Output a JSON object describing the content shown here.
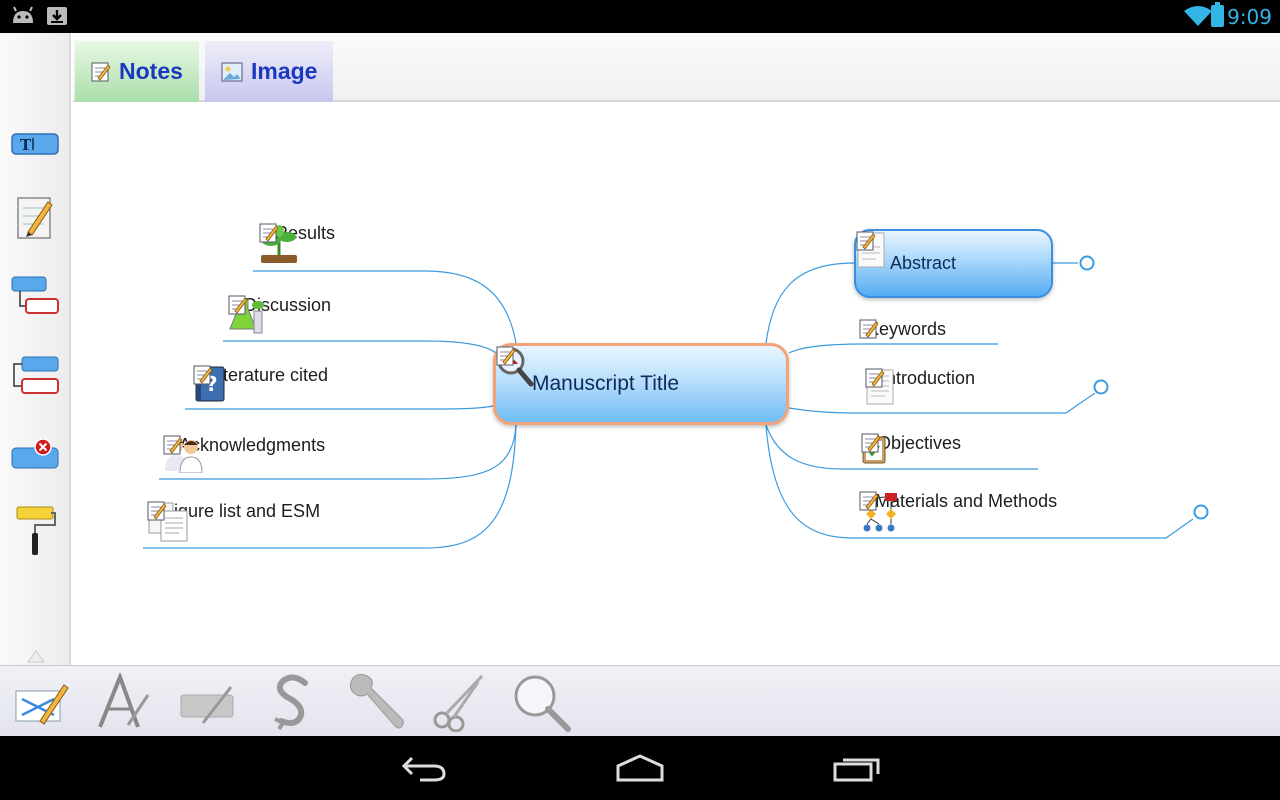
{
  "status_bar": {
    "time": "9:09"
  },
  "tabs": [
    {
      "label": "Notes"
    },
    {
      "label": "Image"
    }
  ],
  "mindmap": {
    "central": "Manuscript Title",
    "left_nodes": [
      {
        "label": "Results",
        "icon": "seedling-icon"
      },
      {
        "label": "Discussion",
        "icon": "flask-icon"
      },
      {
        "label": "Literature cited",
        "icon": "help-book-icon"
      },
      {
        "label": "Acknowledgments",
        "icon": "people-icon"
      },
      {
        "label": "Figure list and ESM",
        "icon": "documents-icon"
      }
    ],
    "right_nodes": [
      {
        "label": "Abstract",
        "icon": "document-icon",
        "selected": true,
        "collapsible": true
      },
      {
        "label": "Keywords",
        "icon": "",
        "collapsible": false
      },
      {
        "label": "Introduction",
        "icon": "document-icon",
        "collapsible": true
      },
      {
        "label": "Objectives",
        "icon": "clipboard-icon",
        "collapsible": false
      },
      {
        "label": "Materials and Methods",
        "icon": "flowchart-icon",
        "collapsible": true
      }
    ]
  },
  "colors": {
    "link": "#3b9be0",
    "tab_text": "#1a39c0",
    "clock": "#33b5e5"
  }
}
